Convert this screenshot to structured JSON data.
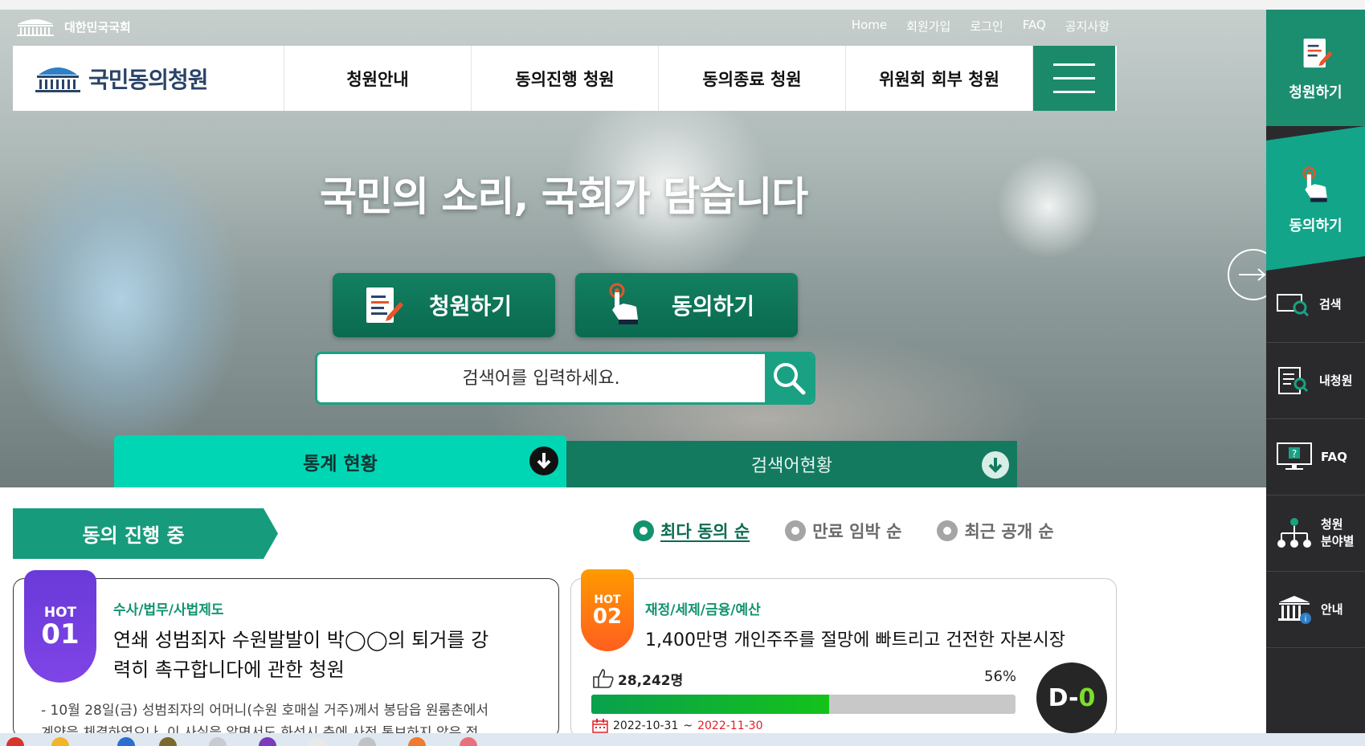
{
  "util": {
    "assembly_label": "대한민국국회",
    "links": [
      "Home",
      "회원가입",
      "로그인",
      "FAQ",
      "공지사항"
    ]
  },
  "brand": {
    "name": "국민동의청원"
  },
  "nav": {
    "items": [
      "청원안내",
      "동의진행 청원",
      "동의종료 청원",
      "위원회 회부 청원"
    ]
  },
  "hero": {
    "title": "국민의 소리, 국회가 담습니다",
    "cta_petition": "청원하기",
    "cta_agree": "동의하기",
    "search_placeholder": "검색어를 입력하세요.",
    "tab_stats": "통계 현황",
    "tab_search": "검색어현황"
  },
  "sidebar": {
    "petition": "청원하기",
    "agree": "동의하기",
    "items": [
      {
        "label": "검색",
        "icon": "search-window-icon"
      },
      {
        "label": "내청원",
        "icon": "my-petition-icon"
      },
      {
        "label": "FAQ",
        "icon": "monitor-question-icon"
      },
      {
        "label": "청원\n분야별",
        "label1": "청원",
        "label2": "분야별",
        "icon": "hierarchy-icon"
      },
      {
        "label": "안내",
        "icon": "assembly-info-icon"
      }
    ]
  },
  "section": {
    "title": "동의 진행 중",
    "sort": [
      "최다 동의 순",
      "만료 임박 순",
      "최근 공개 순"
    ]
  },
  "cards": [
    {
      "hot": "HOT",
      "rank": "01",
      "category": "수사/법무/사법제도",
      "title_line1": "연쇄 성범죄자 수원발발이 박◯◯의 퇴거를 강",
      "title_line2": "력히 촉구합니다에 관한 청원",
      "summary_line1": "- 10월 28일(금) 성범죄자의 어머니(수원 호매실 거주)께서 봉담읍 원룸촌에서",
      "summary_line2": "계약을 체결하였으나, 이 사실을 알면서도 화성시 측에 사전 통보하지 않은 점"
    },
    {
      "hot": "HOT",
      "rank": "02",
      "category": "재정/세제/금융/예산",
      "title_line1": "1,400만명 개인주주를 절망에 빠트리고 건전한 자본시장",
      "likes": "28,242명",
      "percent_label": "56%",
      "percent": 56,
      "start_date": "2022-10-31",
      "date_sep": " ~ ",
      "end_date": "2022-11-30",
      "dday_prefix": "D-",
      "dday_value": "0"
    }
  ],
  "colors": {
    "brand_green": "#1b8a6b",
    "accent_teal": "#00d6b3",
    "hot1": "#7244e0",
    "hot2": "#ff7a10",
    "progress": "#14c21a",
    "end_date": "#e0202a"
  }
}
